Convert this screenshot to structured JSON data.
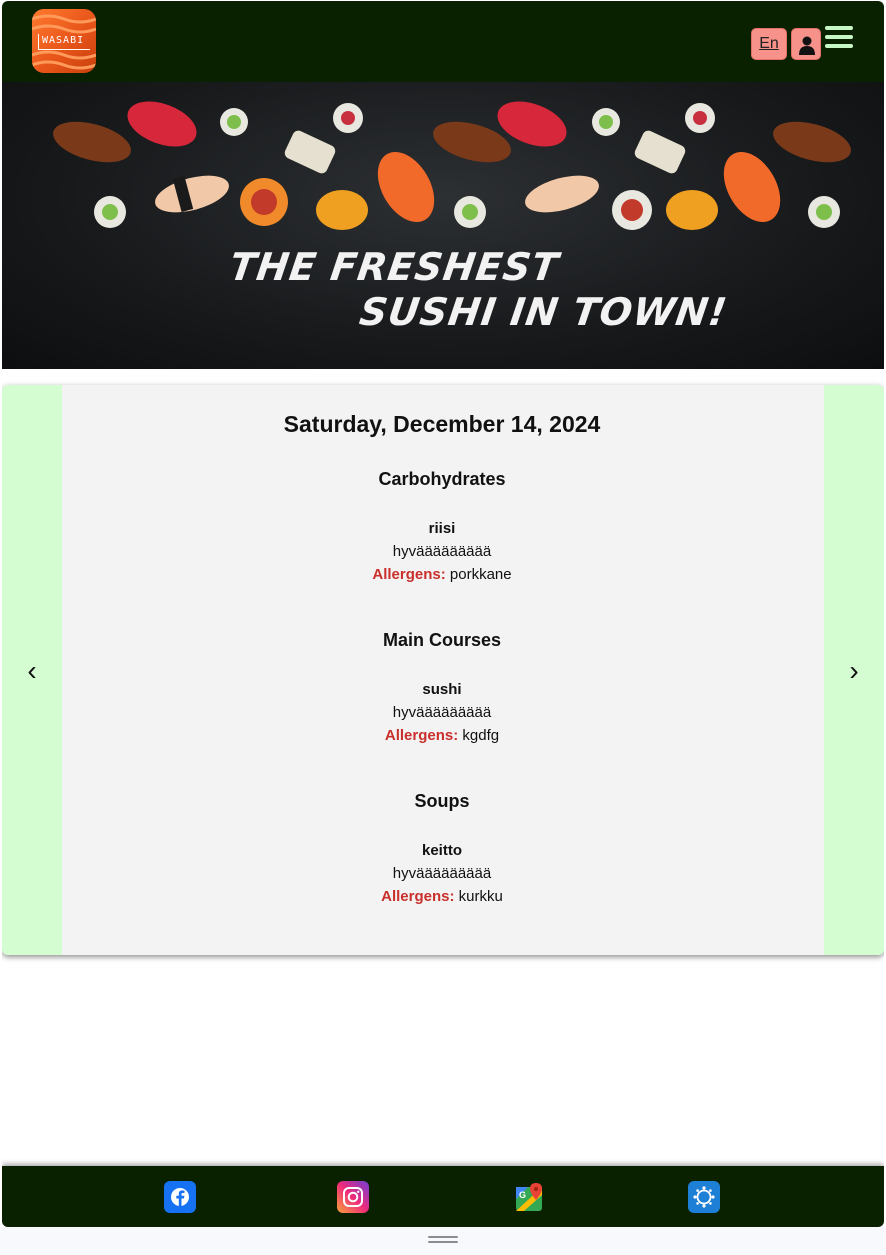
{
  "header": {
    "logo_text": "WASABI",
    "lang_label": "En",
    "icons": {
      "user": "user-icon",
      "menu": "hamburger-menu-icon"
    }
  },
  "hero": {
    "line1": "THE FRESHEST",
    "line2": "SUSHI IN TOWN!"
  },
  "menu": {
    "date": "Saturday, December 14, 2024",
    "prev_label": "‹",
    "next_label": "›",
    "categories": [
      {
        "title": "Carbohydrates",
        "dish": {
          "name": "riisi",
          "description": "hyväääääääää",
          "allergens_label": "Allergens:",
          "allergens": "porkkane"
        }
      },
      {
        "title": "Main Courses",
        "dish": {
          "name": "sushi",
          "description": "hyväääääääää",
          "allergens_label": "Allergens:",
          "allergens": "kgdfg"
        }
      },
      {
        "title": "Soups",
        "dish": {
          "name": "keitto",
          "description": "hyväääääääää",
          "allergens_label": "Allergens:",
          "allergens": "kurkku"
        }
      }
    ]
  },
  "footer": {
    "icons": [
      "facebook-icon",
      "instagram-icon",
      "google-maps-icon",
      "website-icon"
    ]
  },
  "colors": {
    "header_bg": "#0a2100",
    "accent_pink": "#f6928a",
    "side_green": "#d5fdd2",
    "allergen_red": "#c9302c"
  }
}
